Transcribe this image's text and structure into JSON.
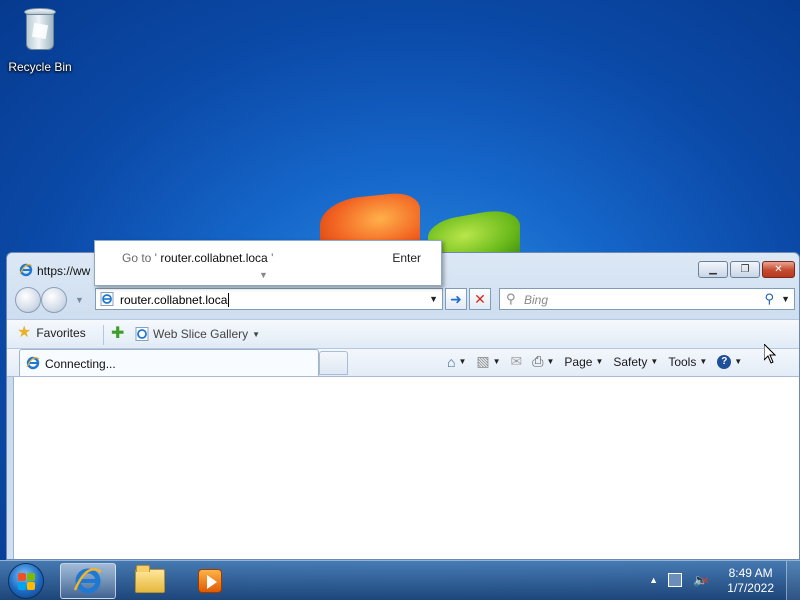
{
  "desktop": {
    "icons": [
      {
        "label": "Recycle Bin",
        "icon": "recycle-bin-icon"
      }
    ]
  },
  "browser": {
    "title": "https://ww",
    "address": {
      "value": "router.collabnet.loca",
      "suggestion_prefix": "Go to '",
      "suggestion_url": "router.collabnet.loca",
      "suggestion_suffix": "'",
      "suggestion_action": "Enter"
    },
    "search": {
      "placeholder": "Bing"
    },
    "favorites": {
      "label": "Favorites",
      "web_slice_label": "Web Slice Gallery"
    },
    "tab": {
      "label": "Connecting..."
    },
    "commands": {
      "page_label": "Page",
      "safety_label": "Safety",
      "tools_label": "Tools"
    },
    "caption_icons": [
      "minimize-icon",
      "restore-icon",
      "close-icon"
    ]
  },
  "taskbar": {
    "pinned": [
      "internet-explorer-icon",
      "windows-explorer-icon",
      "media-player-icon"
    ],
    "clock": {
      "time": "8:49 AM",
      "date": "1/7/2022"
    }
  },
  "colors": {
    "accent": "#1f6fd1",
    "stop": "#d52b1e",
    "close_button": "#c44a2f"
  }
}
